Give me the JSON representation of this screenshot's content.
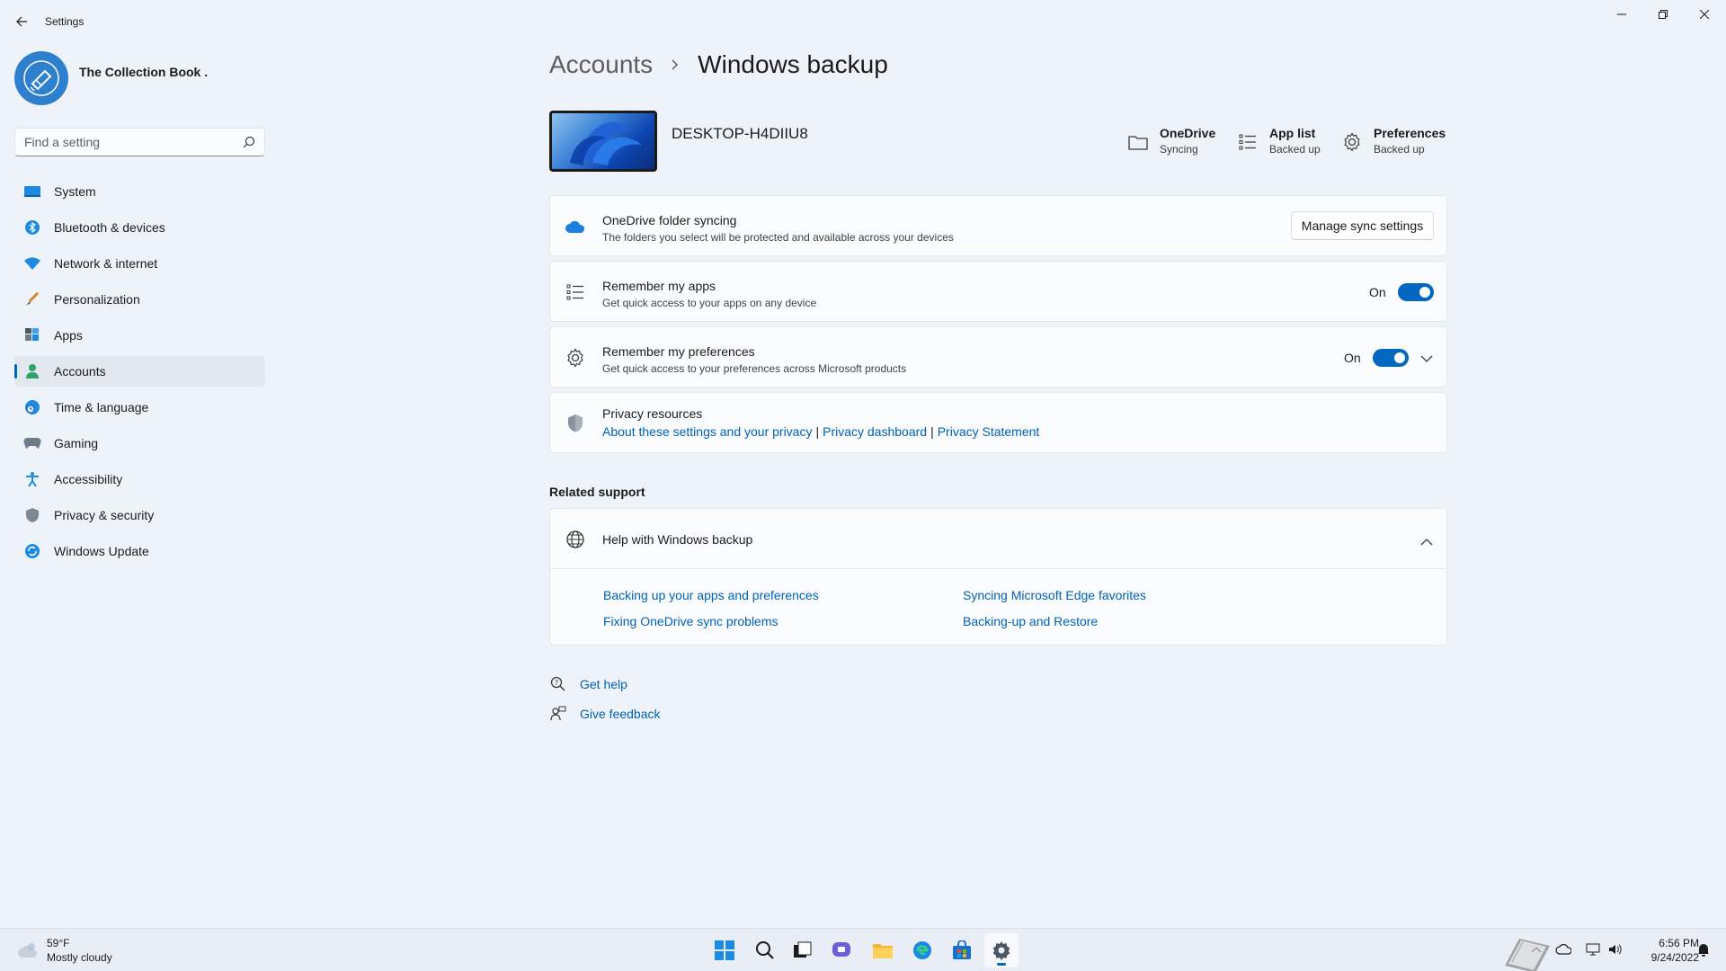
{
  "window": {
    "title": "Settings"
  },
  "profile": {
    "name": "The Collection Book ."
  },
  "search": {
    "placeholder": "Find a setting"
  },
  "sidebar": {
    "items": [
      {
        "label": "System",
        "icon": "monitor-icon"
      },
      {
        "label": "Bluetooth & devices",
        "icon": "bluetooth-icon"
      },
      {
        "label": "Network & internet",
        "icon": "wifi-icon"
      },
      {
        "label": "Personalization",
        "icon": "brush-icon"
      },
      {
        "label": "Apps",
        "icon": "apps-icon"
      },
      {
        "label": "Accounts",
        "icon": "person-icon",
        "active": true
      },
      {
        "label": "Time & language",
        "icon": "globe-clock-icon"
      },
      {
        "label": "Gaming",
        "icon": "gamepad-icon"
      },
      {
        "label": "Accessibility",
        "icon": "accessibility-icon"
      },
      {
        "label": "Privacy & security",
        "icon": "shield-icon"
      },
      {
        "label": "Windows Update",
        "icon": "update-icon"
      }
    ]
  },
  "breadcrumb": {
    "parent": "Accounts",
    "current": "Windows backup"
  },
  "device": {
    "name": "DESKTOP-H4DIIU8"
  },
  "status": [
    {
      "title": "OneDrive",
      "sub": "Syncing",
      "icon": "folder-icon"
    },
    {
      "title": "App list",
      "sub": "Backed up",
      "icon": "list-icon"
    },
    {
      "title": "Preferences",
      "sub": "Backed up",
      "icon": "gear-icon"
    }
  ],
  "cards": {
    "onedrive": {
      "title": "OneDrive folder syncing",
      "desc": "The folders you select will be protected and available across your devices",
      "button": "Manage sync settings"
    },
    "apps": {
      "title": "Remember my apps",
      "desc": "Get quick access to your apps on any device",
      "toggle_label": "On"
    },
    "prefs": {
      "title": "Remember my preferences",
      "desc": "Get quick access to your preferences across Microsoft products",
      "toggle_label": "On"
    },
    "privacy": {
      "title": "Privacy resources",
      "links": [
        "About these settings and your privacy",
        "Privacy dashboard",
        "Privacy Statement"
      ],
      "separator": "|"
    }
  },
  "related": {
    "heading": "Related support",
    "help_title": "Help with Windows backup",
    "links": [
      "Backing up your apps and preferences",
      "Syncing Microsoft Edge favorites",
      "Fixing OneDrive sync problems",
      "Backing-up and Restore"
    ]
  },
  "footer": {
    "get_help": "Get help",
    "feedback": "Give feedback"
  },
  "taskbar": {
    "weather_temp": "59°F",
    "weather_desc": "Mostly cloudy",
    "time": "6:56 PM",
    "date": "9/24/2022"
  },
  "colors": {
    "accent": "#0067c0",
    "link": "#0060b8",
    "background": "#eef3f9"
  }
}
